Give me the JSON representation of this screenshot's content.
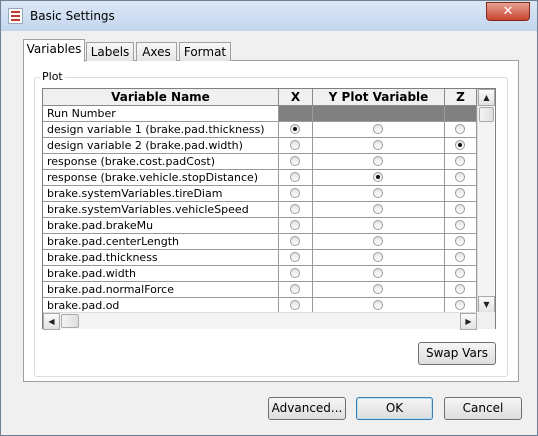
{
  "window": {
    "title": "Basic Settings",
    "close_glyph": "✕"
  },
  "tabs": [
    {
      "label": "Variables",
      "active": true
    },
    {
      "label": "Labels",
      "active": false
    },
    {
      "label": "Axes",
      "active": false
    },
    {
      "label": "Format",
      "active": false
    }
  ],
  "plot_group": {
    "label": "Plot"
  },
  "table": {
    "columns": [
      "Variable Name",
      "X",
      "Y Plot Variable",
      "Z"
    ],
    "rows": [
      {
        "name": "Run Number",
        "header_row": true,
        "x": null,
        "y": null,
        "z": null
      },
      {
        "name": "design variable 1 (brake.pad.thickness)",
        "x": true,
        "y": false,
        "z": false
      },
      {
        "name": "design variable 2 (brake.pad.width)",
        "x": false,
        "y": false,
        "z": true
      },
      {
        "name": "response (brake.cost.padCost)",
        "x": false,
        "y": false,
        "z": false
      },
      {
        "name": "response (brake.vehicle.stopDistance)",
        "x": false,
        "y": true,
        "z": false
      },
      {
        "name": "brake.systemVariables.tireDiam",
        "x": false,
        "y": false,
        "z": false
      },
      {
        "name": "brake.systemVariables.vehicleSpeed",
        "x": false,
        "y": false,
        "z": false
      },
      {
        "name": "brake.pad.brakeMu",
        "x": false,
        "y": false,
        "z": false
      },
      {
        "name": "brake.pad.centerLength",
        "x": false,
        "y": false,
        "z": false
      },
      {
        "name": "brake.pad.thickness",
        "x": false,
        "y": false,
        "z": false
      },
      {
        "name": "brake.pad.width",
        "x": false,
        "y": false,
        "z": false
      },
      {
        "name": "brake.pad.normalForce",
        "x": false,
        "y": false,
        "z": false
      },
      {
        "name": "brake.pad.od",
        "x": false,
        "y": false,
        "z": false
      }
    ]
  },
  "scroll": {
    "up": "▲",
    "down": "▼",
    "left": "◀",
    "right": "▶"
  },
  "buttons": {
    "swap_vars": "Swap Vars",
    "advanced": "Advanced...",
    "ok": "OK",
    "cancel": "Cancel"
  },
  "icons": {
    "app": "settings-list-icon",
    "close": "close-icon"
  }
}
